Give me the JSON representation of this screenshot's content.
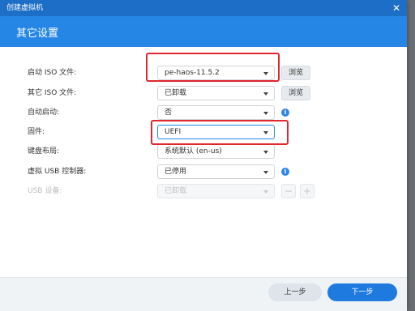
{
  "window": {
    "title": "创建虚拟机",
    "close_icon": "close-icon"
  },
  "header": {
    "title": "其它设置"
  },
  "form": {
    "boot_iso": {
      "label": "启动 ISO 文件:",
      "value": "pe-haos-11.5.2",
      "browse_label": "浏览"
    },
    "other_iso": {
      "label": "其它 ISO 文件:",
      "value": "已卸载",
      "browse_label": "浏览"
    },
    "autostart": {
      "label": "自动启动:",
      "value": "否"
    },
    "firmware": {
      "label": "固件:",
      "value": "UEFI"
    },
    "keyboard": {
      "label": "键盘布局:",
      "value": "系统默认 (en-us)"
    },
    "usb_controller": {
      "label": "虚拟 USB 控制器:",
      "value": "已停用"
    },
    "usb_device": {
      "label": "USB 设备:",
      "value": "已卸载",
      "minus": "−",
      "plus": "+"
    }
  },
  "footer": {
    "prev_label": "上一步",
    "next_label": "下一步"
  },
  "colors": {
    "titlebar": "#1c6ec7",
    "header": "#2686e6",
    "primary_button": "#1f7ae0",
    "highlight": "#e0262f"
  }
}
